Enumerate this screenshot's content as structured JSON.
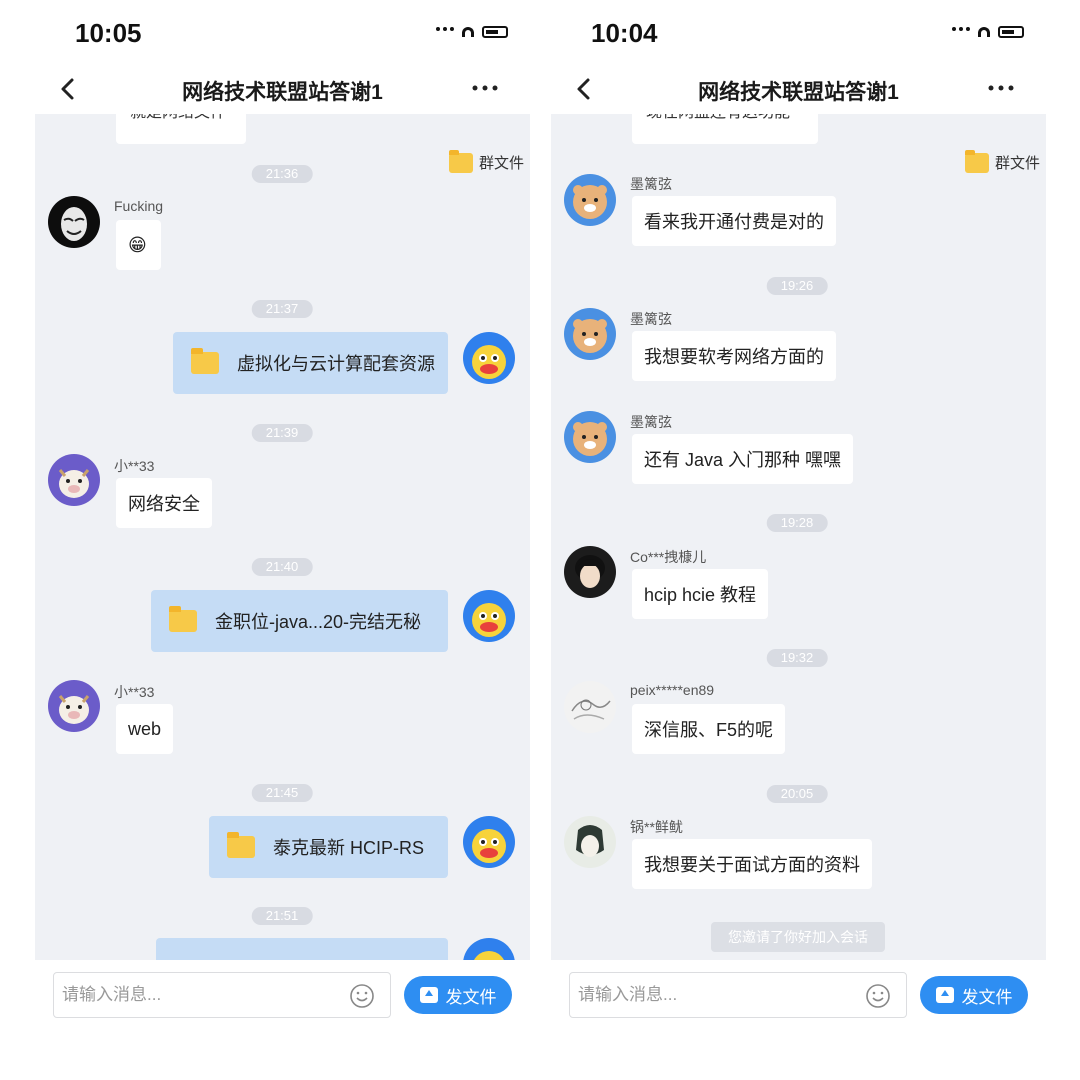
{
  "left": {
    "status_time": "10:05",
    "title": "网络技术联盟站答谢1",
    "partial_text": "就是网络文件",
    "group_files": "群文件",
    "times": [
      "21:36",
      "21:37",
      "21:39",
      "21:40",
      "21:45",
      "21:51"
    ],
    "msg1": {
      "sender": "Fucking",
      "text": "😁"
    },
    "file1": "虚拟化与云计算配套资源",
    "msg2": {
      "sender": "小**33",
      "text": "网络安全"
    },
    "file2": "金职位-java...20-完结无秘",
    "msg3": {
      "sender": "小**33",
      "text": "web"
    },
    "file3": "泰克最新 HCIP-RS",
    "input_placeholder": "请输入消息...",
    "send_file_label": "发文件"
  },
  "right": {
    "status_time": "10:04",
    "title": "网络技术联盟站答谢1",
    "partial_text": "现在网盘还有这功能",
    "group_files": "群文件",
    "times": [
      "19:26",
      "19:28",
      "19:32",
      "20:05"
    ],
    "msg1": {
      "sender": "墨篱弦",
      "text": "看来我开通付费是对的"
    },
    "msg2": {
      "sender": "墨篱弦",
      "text": "我想要软考网络方面的"
    },
    "msg3": {
      "sender": "墨篱弦",
      "text": "还有 Java 入门那种  嘿嘿"
    },
    "msg4": {
      "sender": "Co***拽槺儿",
      "text": "hcip hcie 教程"
    },
    "msg5": {
      "sender": "peix*****en89",
      "text": "深信服、F5的呢"
    },
    "msg6": {
      "sender": "锅**鲜鱿",
      "text": "我想要关于面试方面的资料"
    },
    "system_notice": "您邀请了你好加入会话",
    "input_placeholder": "请输入消息...",
    "send_file_label": "发文件"
  },
  "colors": {
    "chat_bg": "#eff1f5",
    "file_bubble": "#c5dcf5",
    "send_button": "#2e8ef2",
    "folder": "#f7c948"
  }
}
